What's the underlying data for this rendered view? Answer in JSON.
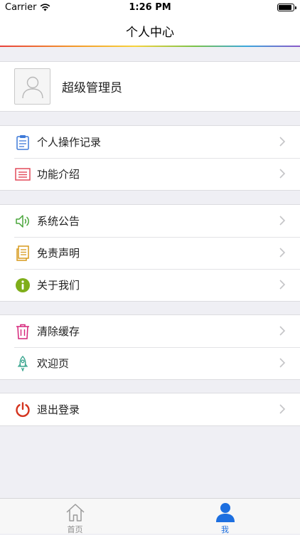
{
  "status_bar": {
    "carrier": "Carrier",
    "time": "1:26 PM",
    "battery_level": 0.9
  },
  "nav": {
    "title": "个人中心"
  },
  "profile": {
    "name": "超级管理员"
  },
  "menu": [
    {
      "label": "个人操作记录",
      "icon": "clipboard-icon",
      "color": "#3f7ad8"
    },
    {
      "label": "功能介绍",
      "icon": "list-icon",
      "color": "#e24a5a"
    },
    {
      "label": "系统公告",
      "icon": "speaker-icon",
      "color": "#4aa63b"
    },
    {
      "label": "免责声明",
      "icon": "document-icon",
      "color": "#d79a1d"
    },
    {
      "label": "关于我们",
      "icon": "info-icon",
      "color": "#7fae1a"
    },
    {
      "label": "清除缓存",
      "icon": "trash-icon",
      "color": "#d6247a"
    },
    {
      "label": "欢迎页",
      "icon": "rocket-icon",
      "color": "#3aa68f"
    },
    {
      "label": "退出登录",
      "icon": "power-icon",
      "color": "#d4331e"
    }
  ],
  "tabs": [
    {
      "label": "首页",
      "icon": "home-icon",
      "active": false
    },
    {
      "label": "我",
      "icon": "user-icon",
      "active": true
    }
  ],
  "colors": {
    "accent": "#1d6fe0",
    "background": "#efeff4"
  }
}
